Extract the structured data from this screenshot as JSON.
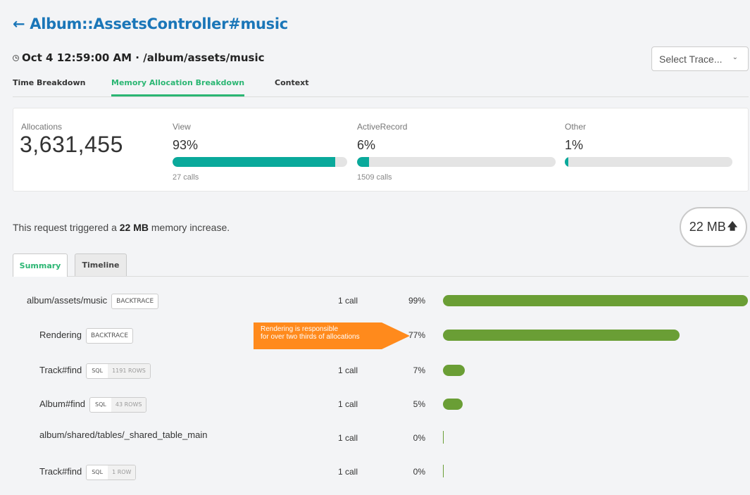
{
  "header": {
    "back_title": "← Album::AssetsController#music",
    "subtitle": "Oct 4 12:59:00 AM · /album/assets/music",
    "trace_select": "Select Trace..."
  },
  "tabs": [
    "Time Breakdown",
    "Memory Allocation Breakdown",
    "Context"
  ],
  "active_tab": "Memory Allocation Breakdown",
  "stats": {
    "allocations_label": "Allocations",
    "allocations_value": "3,631,455",
    "categories": [
      {
        "label": "View",
        "pct": "93%",
        "fraction": 0.93,
        "calls": "27 calls"
      },
      {
        "label": "ActiveRecord",
        "pct": "6%",
        "fraction": 0.06,
        "calls": "1509 calls"
      },
      {
        "label": "Other",
        "pct": "1%",
        "fraction": 0.01,
        "calls": ""
      }
    ],
    "bar_color": "#0aa99b"
  },
  "memory": {
    "text_before": "This request triggered a ",
    "amount": "22 MB",
    "text_after": " memory increase.",
    "badge": "22 MB"
  },
  "subtabs": [
    "Summary",
    "Timeline"
  ],
  "active_subtab": "Summary",
  "rows": [
    {
      "name": "album/assets/music",
      "tag": "BACKTRACE",
      "calls": "1 call",
      "pct": "99%",
      "fraction": 0.99
    },
    {
      "name": "Rendering",
      "tag": "BACKTRACE",
      "calls": "",
      "pct": "77%",
      "fraction": 0.77
    },
    {
      "name": "Track#find",
      "sql": "SQL",
      "rows_label": "1191 ROWS",
      "calls": "1 call",
      "pct": "7%",
      "fraction": 0.07
    },
    {
      "name": "Album#find",
      "sql": "SQL",
      "rows_label": "43 ROWS",
      "calls": "1 call",
      "pct": "5%",
      "fraction": 0.05
    },
    {
      "name": "album/shared/tables/_shared_table_main",
      "calls": "1 call",
      "pct": "0%",
      "fraction": 0.0
    },
    {
      "name": "Track#find",
      "sql": "SQL",
      "rows_label": "1 ROW",
      "calls": "1 call",
      "pct": "0%",
      "fraction": 0.0
    }
  ],
  "callout": {
    "line1": "Rendering is responsible",
    "line2": "for over two thirds of allocations"
  },
  "colors": {
    "title": "#1a76b8",
    "active_tab": "#2bb673",
    "row_bar": "#6a9e35",
    "callout": "#ff8a1c"
  }
}
